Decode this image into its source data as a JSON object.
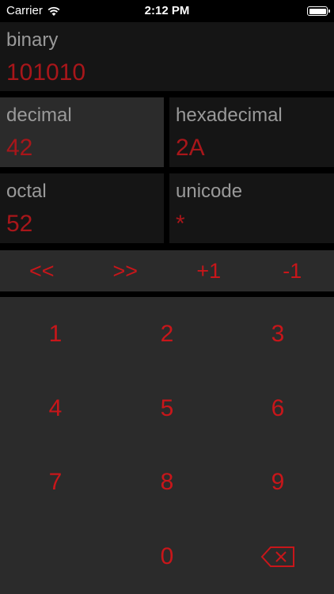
{
  "status_bar": {
    "carrier": "Carrier",
    "time": "2:12 PM"
  },
  "panels": {
    "binary": {
      "label": "binary",
      "value": "101010"
    },
    "decimal": {
      "label": "decimal",
      "value": "42",
      "selected": true
    },
    "hexadecimal": {
      "label": "hexadecimal",
      "value": "2A"
    },
    "octal": {
      "label": "octal",
      "value": "52"
    },
    "unicode": {
      "label": "unicode",
      "value": "*"
    }
  },
  "operations": [
    "<<",
    ">>",
    "+1",
    "-1"
  ],
  "keypad": {
    "keys": [
      "1",
      "2",
      "3",
      "4",
      "5",
      "6",
      "7",
      "8",
      "9",
      "0"
    ],
    "backspace_icon": "backspace-icon"
  },
  "colors": {
    "accent": "#c8161a",
    "value_text": "#a8161a",
    "label_text": "#9a9a9a",
    "panel_bg": "#151515",
    "selected_panel_bg": "#2b2b2b",
    "keypad_bg": "#2b2b2b"
  }
}
